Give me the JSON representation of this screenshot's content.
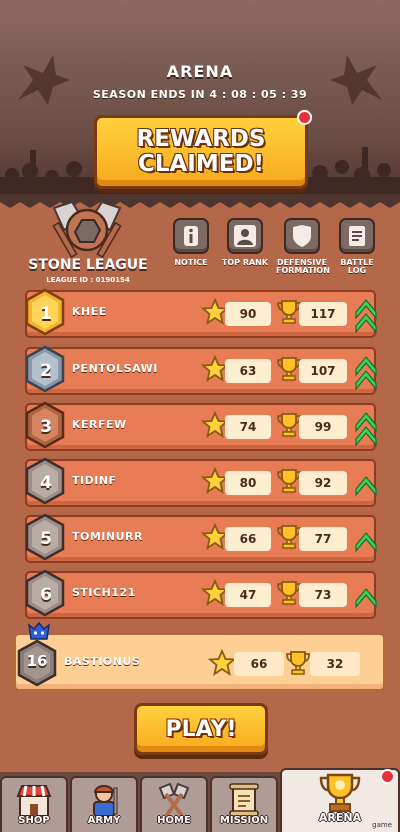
{
  "header": {
    "title": "ARENA",
    "season_text": "SEASON ENDS IN 4 : 08 : 05 : 39",
    "rewards_button": "REWARDS\nCLAIMED!"
  },
  "league": {
    "name": "STONE LEAGUE",
    "id_text": "LEAGUE ID : 0190154"
  },
  "tools": [
    {
      "label": "NOTICE",
      "icon": "info-icon"
    },
    {
      "label": "TOP RANK",
      "icon": "person-icon"
    },
    {
      "label": "DEFENSIVE\nFORMATION",
      "icon": "shield-icon"
    },
    {
      "label": "BATTLE LOG",
      "icon": "scroll-icon"
    }
  ],
  "leaderboard": [
    {
      "rank": "1",
      "name": "KHEE",
      "stars": "90",
      "trophies": "117",
      "chevrons": 2
    },
    {
      "rank": "2",
      "name": "PENTOLSAWI",
      "stars": "63",
      "trophies": "107",
      "chevrons": 2
    },
    {
      "rank": "3",
      "name": "KERFEW",
      "stars": "74",
      "trophies": "99",
      "chevrons": 2
    },
    {
      "rank": "4",
      "name": "TIDINF",
      "stars": "80",
      "trophies": "92",
      "chevrons": 1
    },
    {
      "rank": "5",
      "name": "TOMINURR",
      "stars": "66",
      "trophies": "77",
      "chevrons": 1
    },
    {
      "rank": "6",
      "name": "STICH121",
      "stars": "47",
      "trophies": "73",
      "chevrons": 1
    }
  ],
  "player": {
    "rank": "16",
    "name": "BASTIONUS",
    "stars": "66",
    "trophies": "32"
  },
  "play_button": "PLAY!",
  "nav": {
    "shop": "SHOP",
    "army": "ARMY",
    "home": "HOME",
    "mission": "MISSION",
    "arena": "ARENA"
  },
  "watermark": "game",
  "colors": {
    "accent_gold": "#f7a91d",
    "row_orange": "#e87d55",
    "chevron_green": "#3ed05a",
    "notification_red": "#ea2f3c"
  }
}
